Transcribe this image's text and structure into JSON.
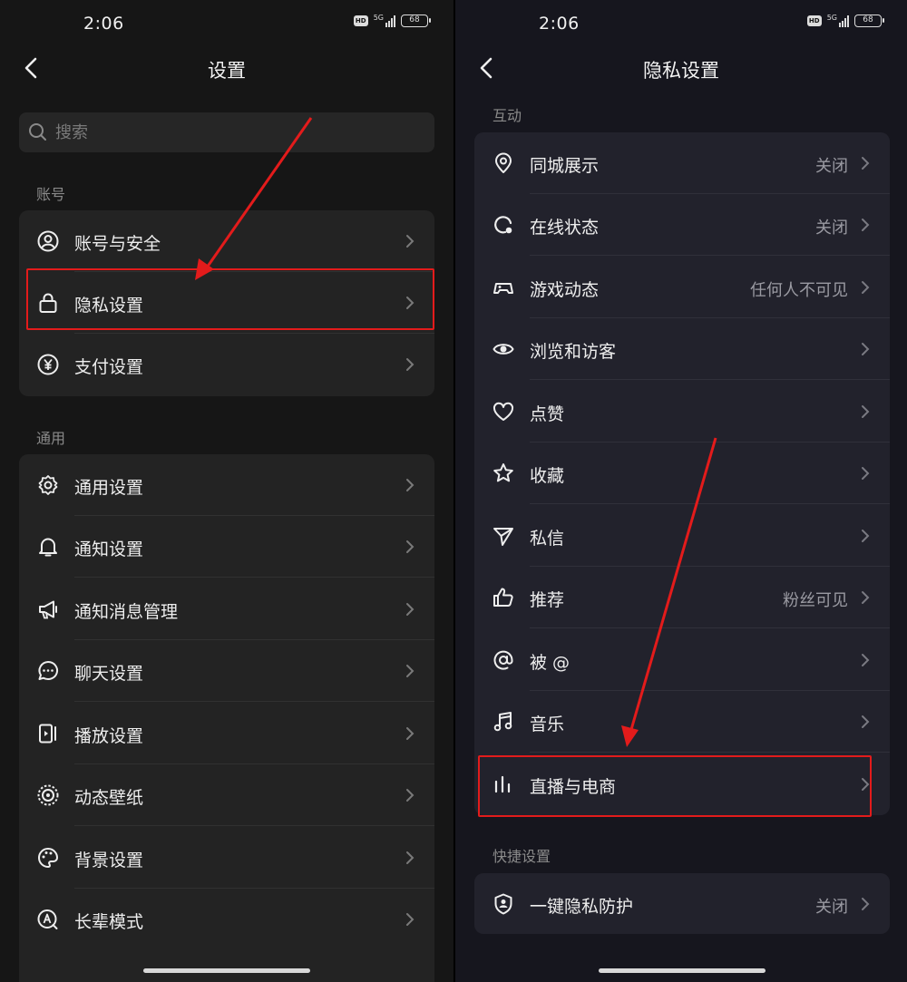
{
  "status": {
    "time": "2:06",
    "hd": "HD",
    "network": "5G",
    "battery": "68"
  },
  "left": {
    "title": "设置",
    "search_placeholder": "搜索",
    "sections": [
      {
        "title": "账号",
        "items": [
          {
            "label": "账号与安全",
            "icon": "user-circle-icon"
          },
          {
            "label": "隐私设置",
            "icon": "lock-icon"
          },
          {
            "label": "支付设置",
            "icon": "yen-icon"
          }
        ]
      },
      {
        "title": "通用",
        "items": [
          {
            "label": "通用设置",
            "icon": "gear-icon"
          },
          {
            "label": "通知设置",
            "icon": "bell-icon"
          },
          {
            "label": "通知消息管理",
            "icon": "megaphone-icon"
          },
          {
            "label": "聊天设置",
            "icon": "chat-bubble-icon"
          },
          {
            "label": "播放设置",
            "icon": "play-screen-icon"
          },
          {
            "label": "动态壁纸",
            "icon": "wallpaper-icon"
          },
          {
            "label": "背景设置",
            "icon": "palette-icon"
          },
          {
            "label": "长辈模式",
            "icon": "elder-mode-icon"
          }
        ]
      }
    ]
  },
  "right": {
    "title": "隐私设置",
    "sections": [
      {
        "title": "互动",
        "items": [
          {
            "label": "同城展示",
            "value": "关闭",
            "icon": "location-pin-icon"
          },
          {
            "label": "在线状态",
            "value": "关闭",
            "icon": "online-status-icon"
          },
          {
            "label": "游戏动态",
            "value": "任何人不可见",
            "icon": "gamepad-icon"
          },
          {
            "label": "浏览和访客",
            "value": "",
            "icon": "eye-icon"
          },
          {
            "label": "点赞",
            "value": "",
            "icon": "heart-icon"
          },
          {
            "label": "收藏",
            "value": "",
            "icon": "star-icon"
          },
          {
            "label": "私信",
            "value": "",
            "icon": "send-icon"
          },
          {
            "label": "推荐",
            "value": "粉丝可见",
            "icon": "thumbs-up-icon"
          },
          {
            "label": "被 @",
            "value": "",
            "icon": "at-icon"
          },
          {
            "label": "音乐",
            "value": "",
            "icon": "music-note-icon"
          },
          {
            "label": "直播与电商",
            "value": "",
            "icon": "live-bars-icon"
          }
        ]
      },
      {
        "title": "快捷设置",
        "items": [
          {
            "label": "一键隐私防护",
            "value": "关闭",
            "icon": "shield-user-icon"
          }
        ]
      }
    ]
  },
  "colors": {
    "highlight": "#e31b1b",
    "background_left": "#161616",
    "background_right": "#16161e"
  }
}
